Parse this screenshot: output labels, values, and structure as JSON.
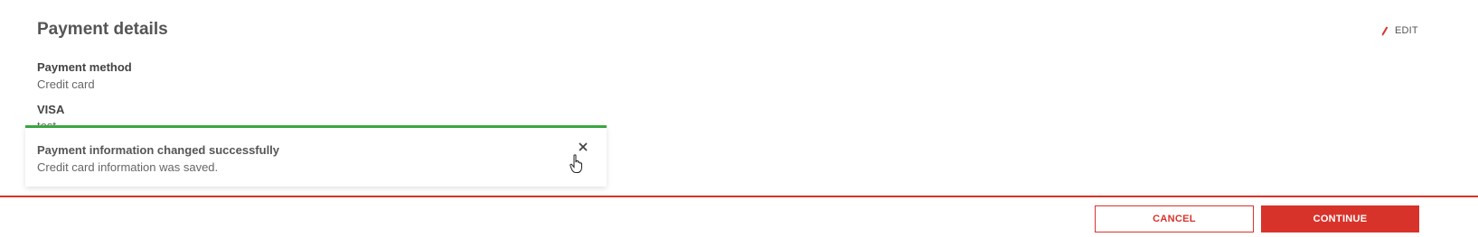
{
  "section": {
    "title": "Payment details",
    "edit_label": "EDIT"
  },
  "payment": {
    "method_label": "Payment method",
    "method_value": "Credit card",
    "card_label": "VISA",
    "card_value": "test"
  },
  "toast": {
    "title": "Payment information changed successfully",
    "message": "Credit card information was saved.",
    "status_color": "#3aa641"
  },
  "actions": {
    "cancel_label": "CANCEL",
    "continue_label": "CONTINUE"
  },
  "colors": {
    "accent": "#d8332b",
    "success": "#3aa641"
  },
  "icons": {
    "edit": "pencil-icon",
    "close": "close-icon",
    "pointer": "hand-pointer-icon"
  }
}
